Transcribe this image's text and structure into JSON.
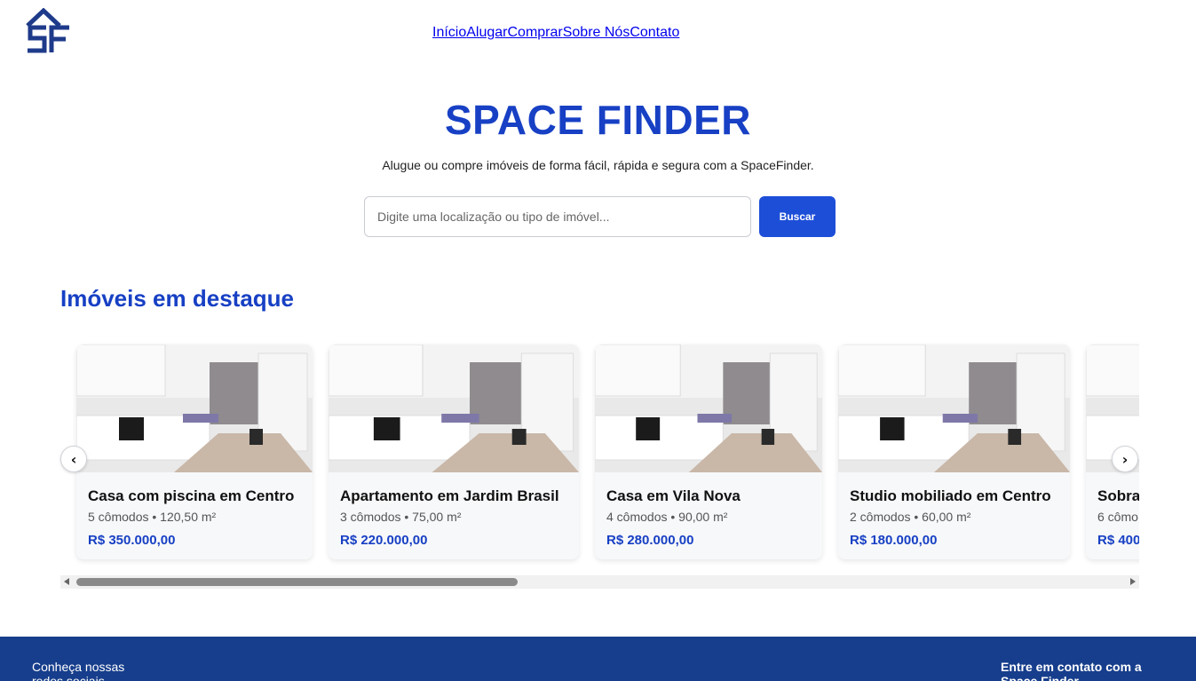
{
  "brand": {
    "logo_text": "SF",
    "color": "#1e3a8a"
  },
  "nav": {
    "items": [
      {
        "label": "Início",
        "active": true
      },
      {
        "label": "Alugar",
        "active": false
      },
      {
        "label": "Comprar",
        "active": false
      },
      {
        "label": "Sobre Nós",
        "active": false
      },
      {
        "label": "Contato",
        "active": false
      }
    ]
  },
  "hero": {
    "title": "SPACE FINDER",
    "subtitle": "Alugue ou compre imóveis de forma fácil, rápida e segura com a SpaceFinder."
  },
  "search": {
    "placeholder": "Digite uma localização ou tipo de imóvel...",
    "button_label": "Buscar"
  },
  "featured": {
    "title": "Imóveis em destaque",
    "prev_icon": "‹",
    "next_icon": "›",
    "cards": [
      {
        "title": "Casa com piscina em Centro",
        "meta": "5 cômodos • 120,50 m²",
        "price": "R$ 350.000,00"
      },
      {
        "title": "Apartamento em Jardim Brasil",
        "meta": "3 cômodos • 75,00 m²",
        "price": "R$ 220.000,00"
      },
      {
        "title": "Casa em Vila Nova",
        "meta": "4 cômodos • 90,00 m²",
        "price": "R$ 280.000,00"
      },
      {
        "title": "Studio mobiliado em Centro",
        "meta": "2 cômodos • 60,00 m²",
        "price": "R$ 180.000,00"
      },
      {
        "title": "Sobra",
        "meta": "6 cômo",
        "price": "R$ 400"
      }
    ]
  },
  "footer": {
    "social_text": "Conheça nossas redes sociais",
    "contact_text": "Entre em contato com a Space Finder"
  },
  "colors": {
    "accent": "#1740c4",
    "button": "#1d4ed8",
    "footer": "#173e8c"
  }
}
